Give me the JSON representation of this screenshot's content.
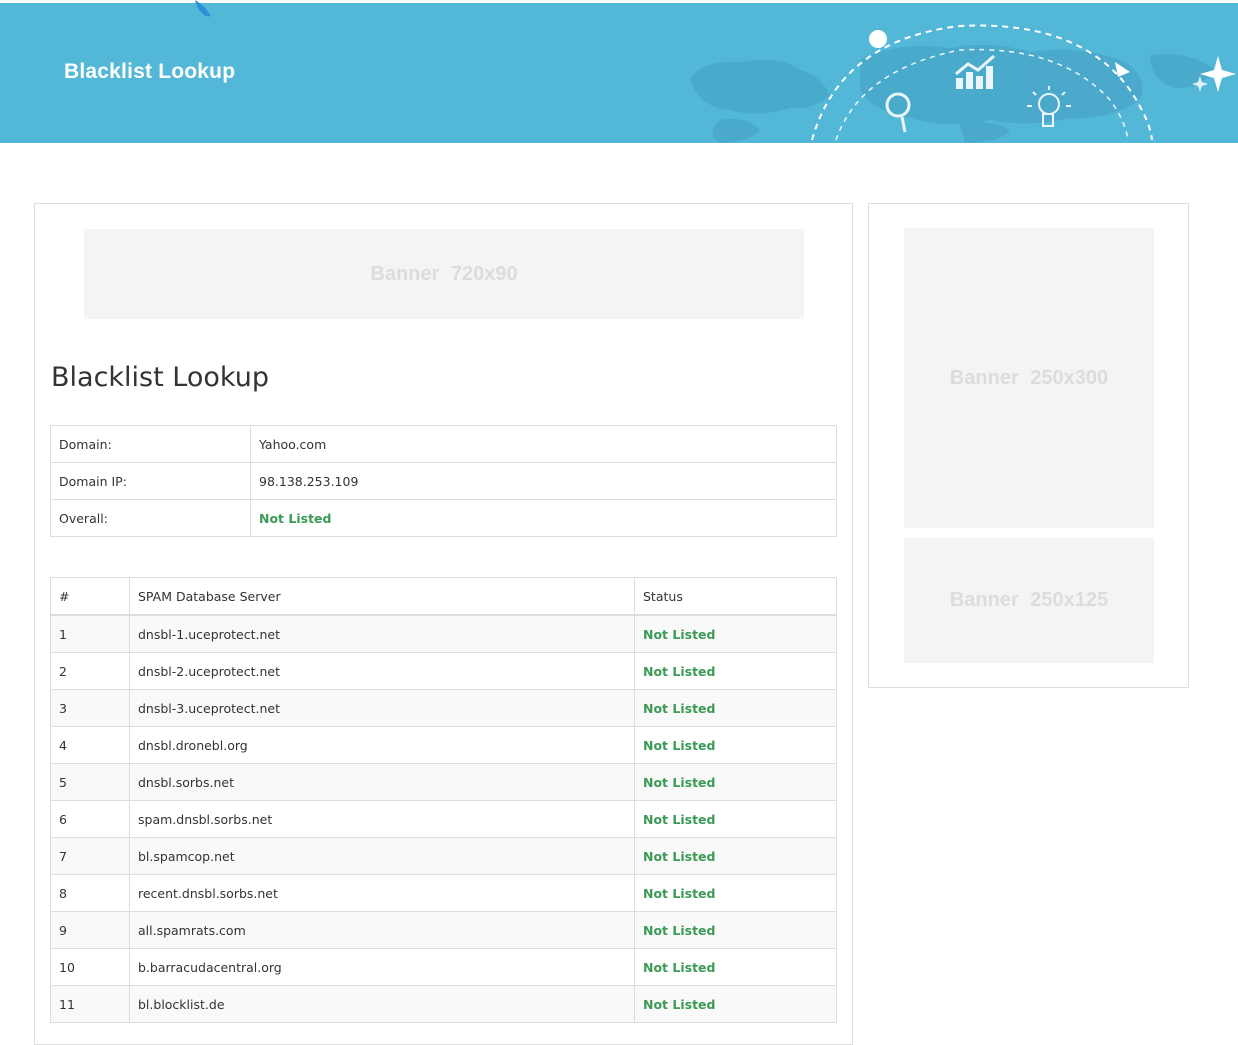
{
  "header": {
    "title": "Blacklist Lookup",
    "background_color": "#53b8d8"
  },
  "banners": {
    "top": "Banner  720x90",
    "side_large": "Banner  250x300",
    "side_small": "Banner  250x125"
  },
  "main": {
    "heading": "Blacklist Lookup",
    "summary": [
      {
        "label": "Domain:",
        "value": "Yahoo.com"
      },
      {
        "label": "Domain IP:",
        "value": "98.138.253.109"
      },
      {
        "label": "Overall:",
        "value": "Not Listed"
      }
    ],
    "results": {
      "columns": [
        "#",
        "SPAM Database Server",
        "Status"
      ],
      "rows": [
        {
          "num": "1",
          "server": "dnsbl-1.uceprotect.net",
          "status": "Not Listed"
        },
        {
          "num": "2",
          "server": "dnsbl-2.uceprotect.net",
          "status": "Not Listed"
        },
        {
          "num": "3",
          "server": "dnsbl-3.uceprotect.net",
          "status": "Not Listed"
        },
        {
          "num": "4",
          "server": "dnsbl.dronebl.org",
          "status": "Not Listed"
        },
        {
          "num": "5",
          "server": "dnsbl.sorbs.net",
          "status": "Not Listed"
        },
        {
          "num": "6",
          "server": "spam.dnsbl.sorbs.net",
          "status": "Not Listed"
        },
        {
          "num": "7",
          "server": "bl.spamcop.net",
          "status": "Not Listed"
        },
        {
          "num": "8",
          "server": "recent.dnsbl.sorbs.net",
          "status": "Not Listed"
        },
        {
          "num": "9",
          "server": "all.spamrats.com",
          "status": "Not Listed"
        },
        {
          "num": "10",
          "server": "b.barracudacentral.org",
          "status": "Not Listed"
        },
        {
          "num": "11",
          "server": "bl.blocklist.de",
          "status": "Not Listed"
        }
      ]
    }
  },
  "colors": {
    "status_ok": "#3c9a57",
    "border": "#dddddd",
    "banner_bg": "#f4f4f4"
  },
  "icons": [
    "chart-icon",
    "magnifier-icon",
    "lightbulb-icon",
    "sparkle-icon",
    "world-map-icon"
  ]
}
